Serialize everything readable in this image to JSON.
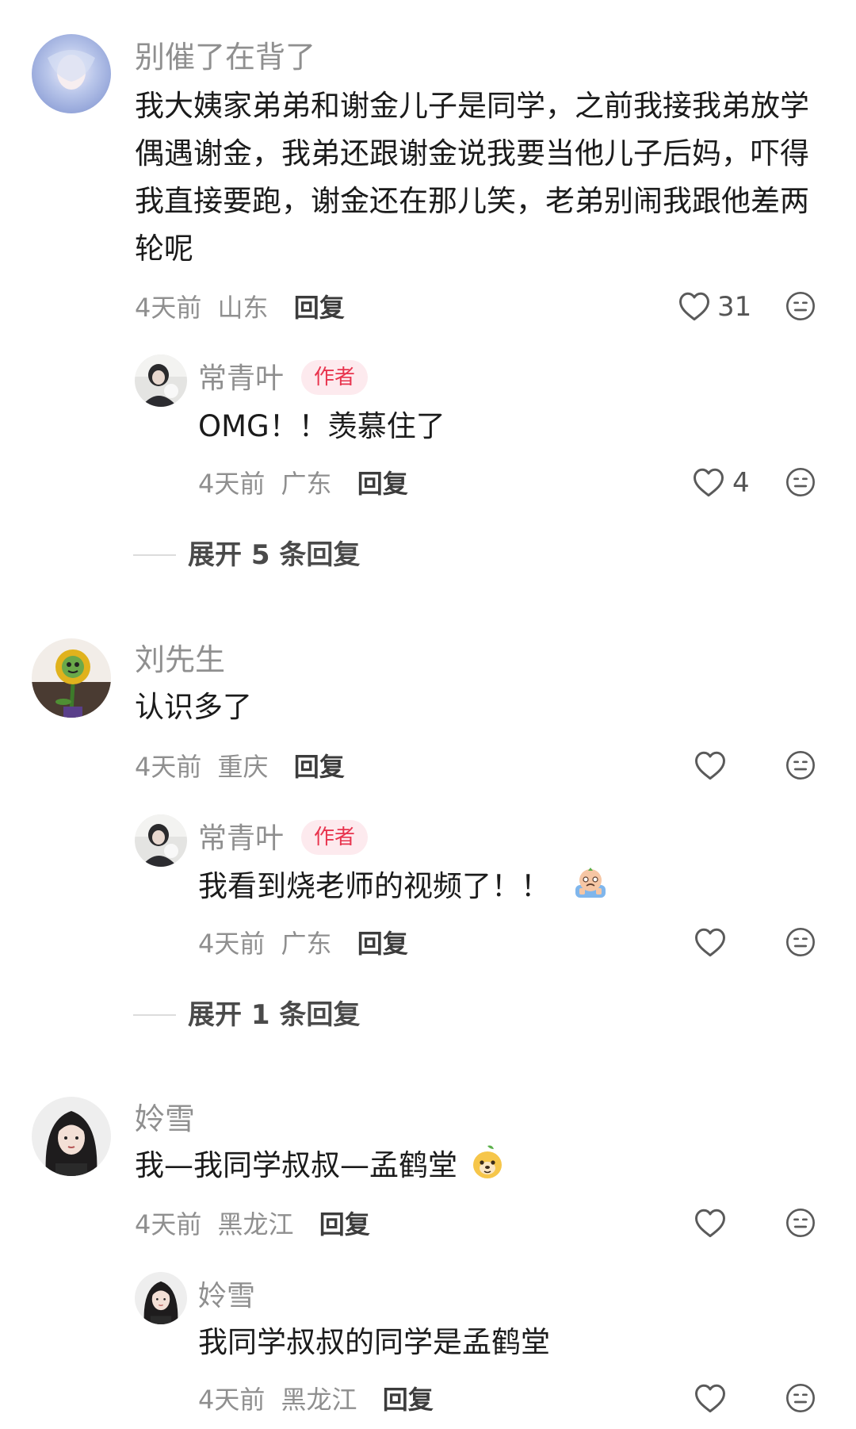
{
  "comments": [
    {
      "author": "别催了在背了",
      "text": "我大姨家弟弟和谢金儿子是同学，之前我接我弟放学偶遇谢金，我弟还跟谢金说我要当他儿子后妈，吓得我直接要跑，谢金还在那儿笑，老弟别闹我跟他差两轮呢",
      "time": "4天前",
      "location": "山东",
      "reply_label": "回复",
      "likes": "31",
      "reply": {
        "author": "常青叶",
        "badge": "作者",
        "text": "OMG！！羡慕住了",
        "time": "4天前",
        "location": "广东",
        "reply_label": "回复",
        "likes": "4"
      },
      "expand_label": "展开 5 条回复"
    },
    {
      "author": "刘先生",
      "text": "认识多了",
      "time": "4天前",
      "location": "重庆",
      "reply_label": "回复",
      "reply": {
        "author": "常青叶",
        "badge": "作者",
        "text": "我看到烧老师的视频了！！",
        "time": "4天前",
        "location": "广东",
        "reply_label": "回复"
      },
      "expand_label": "展开 1 条回复"
    },
    {
      "author": "姈雪",
      "text": "我—我同学叔叔—孟鹤堂",
      "time": "4天前",
      "location": "黑龙江",
      "reply_label": "回复",
      "reply": {
        "author": "姈雪",
        "text": "我同学叔叔的同学是孟鹤堂",
        "time": "4天前",
        "location": "黑龙江",
        "reply_label": "回复"
      }
    }
  ],
  "icons": {
    "like": "heart-outline-icon",
    "dislike": "meh-face-icon",
    "emoji_crying": "crying-emoji",
    "emoji_fruit": "pear-face-emoji"
  },
  "colors": {
    "author_badge_bg": "#fdeaee",
    "author_badge_text": "#e8344e",
    "meta_text": "#8f8f8f"
  }
}
